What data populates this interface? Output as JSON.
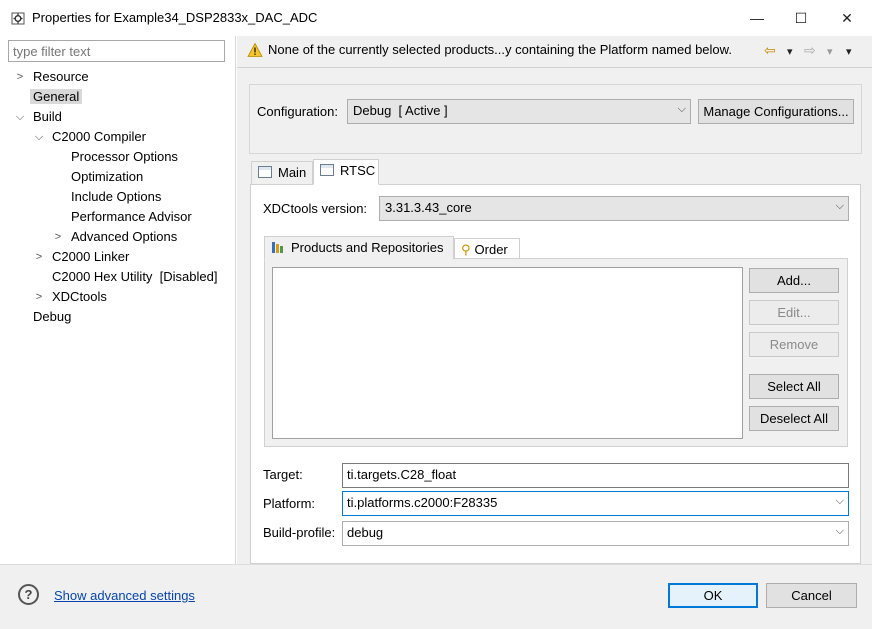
{
  "window": {
    "title": "Properties for Example34_DSP2833x_DAC_ADC",
    "icon": "gear-properties-icon",
    "minimize_glyph": "—",
    "maximize_glyph": "☐",
    "close_glyph": "✕"
  },
  "filter": {
    "placeholder": "type filter text"
  },
  "tree": {
    "items": [
      {
        "label": "Resource",
        "twisty": ">"
      },
      {
        "label": "General"
      },
      {
        "label": "Build",
        "twisty": "⌵"
      },
      {
        "label": "C2000 Compiler",
        "twisty": "⌵"
      },
      {
        "label": "Processor Options"
      },
      {
        "label": "Optimization"
      },
      {
        "label": "Include Options"
      },
      {
        "label": "Performance Advisor"
      },
      {
        "label": "Advanced Options",
        "twisty": ">"
      },
      {
        "label": "C2000 Linker",
        "twisty": ">"
      },
      {
        "label": "C2000 Hex Utility  [Disabled]"
      },
      {
        "label": "XDCtools",
        "twisty": ">"
      },
      {
        "label": "Debug"
      }
    ],
    "selected": "General"
  },
  "message": {
    "text": "None of the currently selected products...y containing the Platform named below.",
    "icon": "warning-icon",
    "back_glyph": "⇦",
    "forward_glyph": "⇨",
    "dropdown_glyph": "▾"
  },
  "configuration": {
    "label": "Configuration:",
    "value": "Debug  [ Active ]",
    "manage_label": "Manage Configurations..."
  },
  "tabs": [
    {
      "label": "Main",
      "active": false
    },
    {
      "label": "RTSC",
      "active": true
    }
  ],
  "rtsc": {
    "xdctools_label": "XDCtools version:",
    "xdctools_value": "3.31.3.43_core",
    "subtabs": [
      {
        "label": "Products and Repositories",
        "active": true
      },
      {
        "label": "Order",
        "active": false
      }
    ],
    "buttons": {
      "add": "Add...",
      "edit": "Edit...",
      "remove": "Remove",
      "select_all": "Select All",
      "deselect_all": "Deselect All"
    },
    "target_label": "Target:",
    "target_value": "ti.targets.C28_float",
    "platform_label": "Platform:",
    "platform_value": "ti.platforms.c2000:F28335",
    "buildprofile_label": "Build-profile:",
    "buildprofile_value": "debug"
  },
  "footer": {
    "help_glyph": "?",
    "advanced_link": "Show advanced settings",
    "ok_label": "OK",
    "cancel_label": "Cancel"
  }
}
